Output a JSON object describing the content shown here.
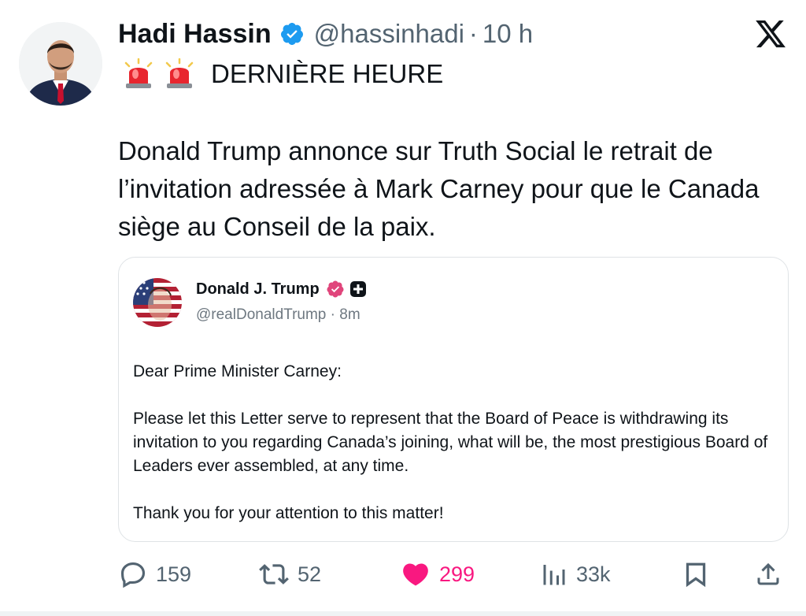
{
  "tweet": {
    "author_name": "Hadi Hassin",
    "handle": "@hassinhadi",
    "separator": "·",
    "time": "10 h",
    "headline_icon": "police-siren-emoji",
    "headline": "DERNIÈRE HEURE",
    "text": "Donald Trump annonce sur Truth Social le retrait de l’invitation adressée à Mark Carney pour que le Canada siège au Conseil de la paix.",
    "platform_icon": "x-logo-icon"
  },
  "quoted_post": {
    "author_name": "Donald J. Trump",
    "handle_time": "@realDonaldTrump · 8m",
    "salutation": "Dear Prime Minister Carney:",
    "paragraph": "Please let this Letter serve to represent that the Board of Peace is withdrawing its invitation to you regarding Canada’s joining, what will be, the most prestigious Board of Leaders ever assembled, at any time.",
    "closing": "Thank you for your attention to this matter!"
  },
  "actions": {
    "replies": "159",
    "reposts": "52",
    "likes": "299",
    "views": "33k"
  },
  "colors": {
    "verified_blue": "#1d9bf0",
    "like_pink": "#f91880",
    "truth_badge": "#e0457b",
    "secondary_text": "#536471"
  }
}
